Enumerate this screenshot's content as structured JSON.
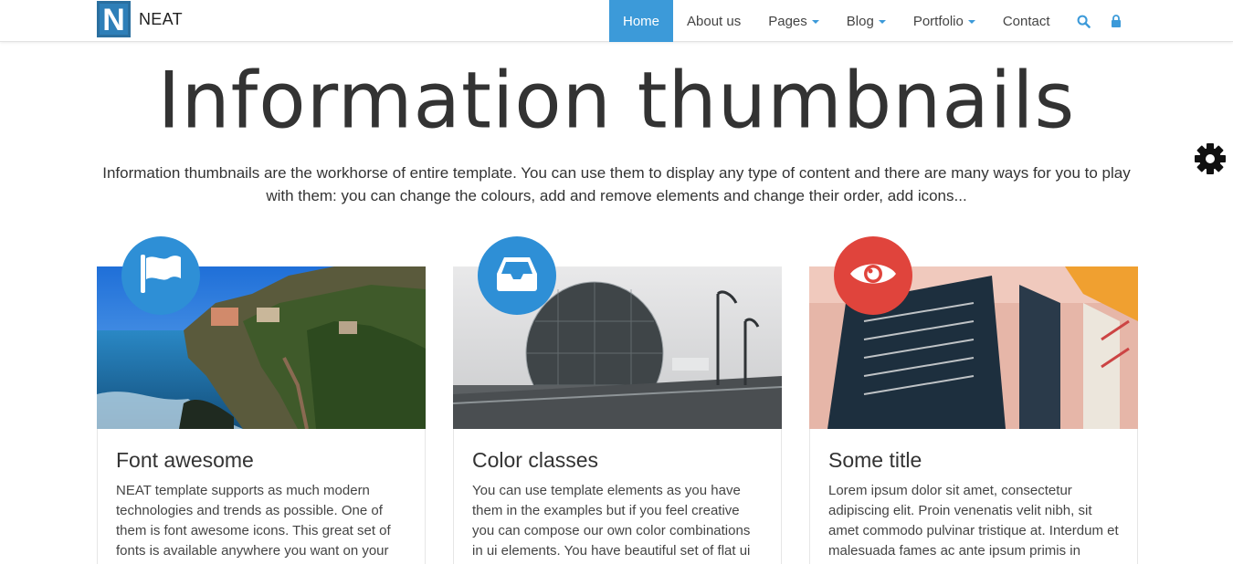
{
  "brand": {
    "logo_letter": "N",
    "name": "NEAT"
  },
  "nav": {
    "items": [
      {
        "label": "Home",
        "active": true,
        "dropdown": false
      },
      {
        "label": "About us",
        "active": false,
        "dropdown": false
      },
      {
        "label": "Pages",
        "active": false,
        "dropdown": true
      },
      {
        "label": "Blog",
        "active": false,
        "dropdown": true
      },
      {
        "label": "Portfolio",
        "active": false,
        "dropdown": true
      },
      {
        "label": "Contact",
        "active": false,
        "dropdown": false
      }
    ],
    "icons": [
      "search-icon",
      "lock-icon"
    ]
  },
  "page": {
    "title": "Information thumbnails",
    "lead": "Information thumbnails are the workhorse of entire template. You can use them to display any type of content and there are many ways for you to play with them: you can change the colours, add and remove elements and change their order, add icons..."
  },
  "settings_icon": "gear-icon",
  "cards": [
    {
      "title": "Font awesome",
      "text": "NEAT template supports as much modern technologies and trends as possible. One of them is font awesome icons. This great set of fonts is available anywhere you want on your",
      "icon": "flag-icon",
      "badge_color": "#2e8fd6"
    },
    {
      "title": "Color classes",
      "text": "You can use template elements as you have them in the examples but if you feel creative you can compose our own color combinations in ui elements. You have beautiful set of flat ui",
      "icon": "inbox-icon",
      "badge_color": "#2e8fd6"
    },
    {
      "title": "Some title",
      "text": "Lorem ipsum dolor sit amet, consectetur adipiscing elit. Proin venenatis velit nibh, sit amet commodo pulvinar tristique at. Interdum et malesuada fames ac ante ipsum primis in",
      "icon": "eye-icon",
      "badge_color": "#e0443c"
    }
  ],
  "colors": {
    "accent": "#3c9ad9",
    "red": "#e0443c",
    "text": "#333333"
  }
}
